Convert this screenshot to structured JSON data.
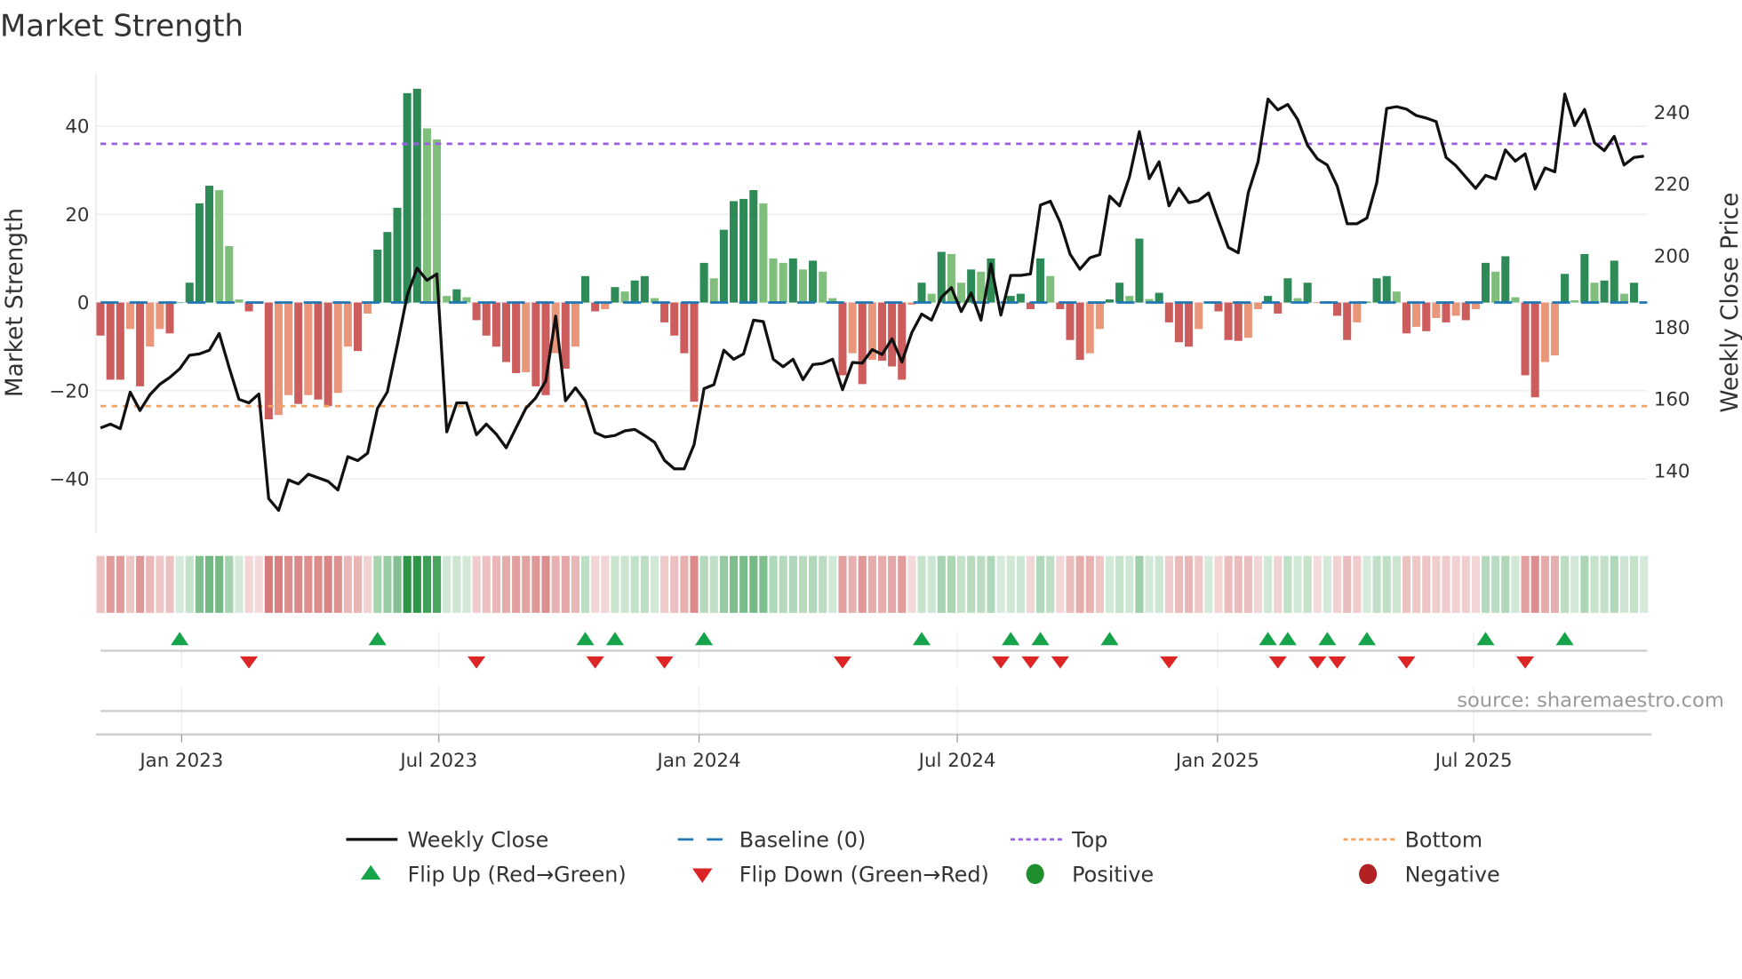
{
  "chart_data": {
    "type": "bar+line",
    "title": "Market Strength",
    "ylabel_left": "Market Strength",
    "ylabel_right": "Weekly Close Price",
    "left_ylim": [
      -52.4,
      52.2
    ],
    "right_ylim": [
      122.4,
      251
    ],
    "left_yticks": [
      {
        "value": -40,
        "label": "−40"
      },
      {
        "value": -20,
        "label": "−20"
      },
      {
        "value": 0,
        "label": "0"
      },
      {
        "value": 20,
        "label": "20"
      },
      {
        "value": 40,
        "label": "40"
      }
    ],
    "right_yticks": [
      {
        "value": 140,
        "label": "140"
      },
      {
        "value": 160,
        "label": "160"
      },
      {
        "value": 180,
        "label": "180"
      },
      {
        "value": 200,
        "label": "200"
      },
      {
        "value": 220,
        "label": "220"
      },
      {
        "value": 240,
        "label": "240"
      }
    ],
    "x_unit": "week index (weekly, starting early Nov 2022)",
    "x_ticks": [
      {
        "week": 8.2,
        "label": "Jan 2023"
      },
      {
        "week": 34.2,
        "label": "Jul 2023"
      },
      {
        "week": 60.5,
        "label": "Jan 2024"
      },
      {
        "week": 86.6,
        "label": "Jul 2024"
      },
      {
        "week": 112.9,
        "label": "Jan 2025"
      },
      {
        "week": 138.8,
        "label": "Jul 2025"
      }
    ],
    "top_level": 36,
    "bottom_level": -23.5,
    "baseline": 0,
    "strength": [
      -7.5,
      -17.5,
      -17.5,
      -6,
      -19,
      -10,
      -6,
      -7,
      0,
      4.5,
      22.5,
      26.5,
      25.5,
      12.8,
      0.7,
      -2,
      -0.3,
      -26.5,
      -25.5,
      -21,
      -23,
      -21,
      -22,
      -23.5,
      -20.5,
      -10,
      -11,
      -2.5,
      12,
      16,
      21.5,
      47.5,
      48.5,
      39.5,
      37,
      1.5,
      3,
      1.2,
      -4,
      -7.5,
      -10,
      -13.5,
      -16,
      -15.8,
      -19,
      -21,
      -11.5,
      -15,
      -10,
      6,
      -2,
      -1.5,
      3.5,
      2.5,
      5,
      6,
      1,
      -4.5,
      -7.5,
      -11.5,
      -22.5,
      9,
      5.5,
      16.5,
      23,
      23.5,
      25.5,
      22.5,
      10,
      9,
      10,
      7.5,
      9.5,
      7,
      1,
      -16.5,
      -11.5,
      -18.5,
      -13,
      -13.2,
      -14.5,
      -17.5,
      -0.5,
      4.5,
      2,
      11.5,
      11,
      4.5,
      7.5,
      7,
      10,
      0,
      1.5,
      2,
      -1.5,
      10,
      6,
      -1.5,
      -8.5,
      -13,
      -11.5,
      -6,
      0.7,
      4.5,
      1.5,
      14.5,
      0.8,
      2.2,
      -4.5,
      -9,
      -10,
      -6,
      0,
      -2,
      -8.5,
      -8.7,
      -8,
      -1.5,
      1.5,
      -2.5,
      5.5,
      1,
      4.5,
      -0.1,
      0.3,
      -3,
      -8.5,
      -4.5,
      0.2,
      5.5,
      6,
      2.5,
      -7,
      -5.5,
      -6.5,
      -3.5,
      -4.5,
      -3,
      -4,
      -1.5,
      9,
      7,
      10.5,
      1.2,
      -16.5,
      -21.5,
      -13.5,
      -12,
      6.5,
      0.5,
      11,
      4.5,
      5,
      9.5,
      2,
      4.5,
      0.2
    ],
    "close": [
      151.9,
      153,
      151.7,
      161.9,
      156.8,
      161.2,
      164.1,
      166,
      168.4,
      172.2,
      172.6,
      173.6,
      178.3,
      168.8,
      159.9,
      158.9,
      161.4,
      132.2,
      128.9,
      137.4,
      136.3,
      139,
      138,
      137,
      134.6,
      143.9,
      142.8,
      144.9,
      157.4,
      162,
      175.1,
      189,
      196.5,
      193.1,
      194.9,
      150.8,
      158.9,
      158.9,
      150,
      153,
      150.2,
      146.4,
      151.9,
      157.4,
      160.3,
      165,
      183.1,
      159.5,
      163.1,
      159.5,
      150.6,
      149.4,
      149.8,
      151.1,
      151.5,
      149.8,
      147.9,
      142.9,
      140.5,
      140.5,
      147.3,
      162.9,
      164,
      173.6,
      171.1,
      172.6,
      182,
      181.6,
      171.1,
      169,
      171.1,
      165.4,
      169.6,
      169.9,
      171.1,
      162.6,
      170.2,
      170,
      173.8,
      172.4,
      176.8,
      170.3,
      178.5,
      183.7,
      182,
      188.4,
      191.1,
      184.4,
      189.6,
      182,
      197.7,
      183.4,
      194.5,
      194.5,
      194.9,
      214.1,
      215.2,
      209.3,
      200.4,
      196.2,
      199.4,
      200.3,
      216.6,
      213.9,
      221.9,
      234.6,
      221.5,
      226.2,
      213.9,
      218.8,
      214.8,
      215.4,
      217.5,
      209.7,
      202.3,
      200.8,
      217.5,
      226.2,
      243.7,
      240.7,
      242.2,
      238,
      230.8,
      227,
      225.3,
      219.4,
      208.9,
      208.9,
      210.5,
      220.3,
      241.1,
      241.6,
      240.9,
      239.1,
      238.4,
      237.4,
      227.4,
      225.1,
      221.9,
      218.8,
      222.4,
      221.4,
      229.5,
      226.4,
      228.4,
      218.6,
      224.5,
      223.4,
      245.1,
      236.3,
      240.8,
      231.5,
      229.3,
      233.3,
      225.3,
      227.4,
      227.8
    ],
    "flip_up_weeks": [
      8,
      28,
      49,
      52,
      61,
      83,
      92,
      95,
      102,
      118,
      120,
      124,
      128,
      140,
      148
    ],
    "flip_down_weeks": [
      15,
      38,
      50,
      57,
      75,
      91,
      94,
      97,
      108,
      119,
      123,
      125,
      132,
      144
    ],
    "legend": [
      {
        "label": "Weekly Close",
        "symbol": "line"
      },
      {
        "label": "Baseline (0)",
        "symbol": "dash"
      },
      {
        "label": "Top",
        "symbol": "dot-purple"
      },
      {
        "label": "Bottom",
        "symbol": "dot-orange"
      },
      {
        "label": "Flip Up (Red→Green)",
        "symbol": "triangle-up"
      },
      {
        "label": "Flip Down (Green→Red)",
        "symbol": "triangle-down"
      },
      {
        "label": "Positive",
        "symbol": "circle-green"
      },
      {
        "label": "Negative",
        "symbol": "circle-red"
      }
    ],
    "source": "source: sharemaestro.com"
  },
  "colors": {
    "pos_strong": "#2e8b57",
    "pos_weak": "#7fbf7b",
    "neg_strong": "#cd5c5c",
    "neg_weak": "#e9967a",
    "close": "#111111",
    "baseline": "#1f77b4",
    "top": "#9b5de5",
    "bottom": "#f4a261",
    "flip_up": "#16a34a",
    "flip_down": "#dc2626",
    "positive": "#1f8f2e",
    "negative": "#b22222"
  }
}
